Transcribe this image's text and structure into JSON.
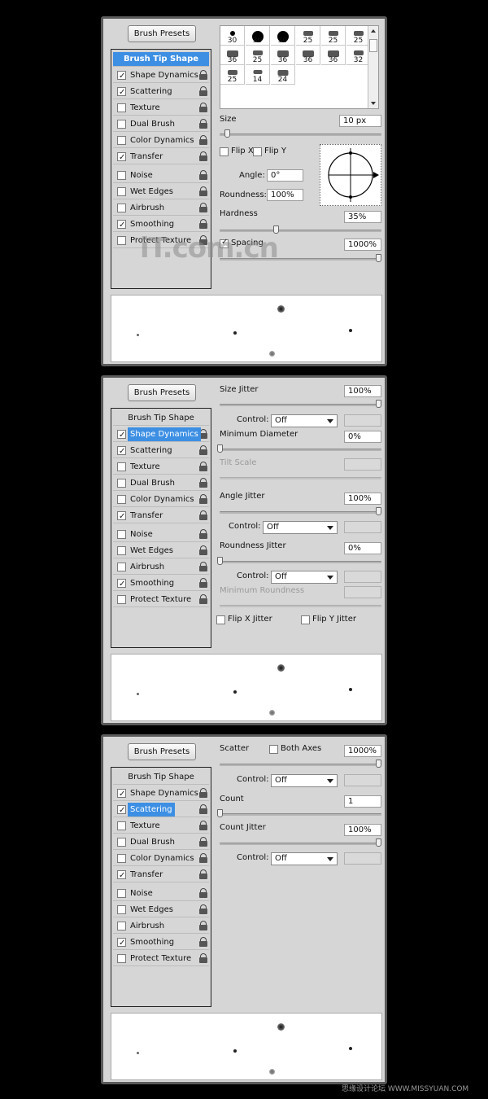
{
  "panels": [
    {
      "presets_label": "Brush Presets",
      "selected": "Brush Tip Shape",
      "sidebar": [
        {
          "label": "Brush Tip Shape",
          "title": true,
          "selected": true
        },
        {
          "label": "Shape Dynamics",
          "checked": true
        },
        {
          "label": "Scattering",
          "checked": true
        },
        {
          "label": "Texture",
          "checked": false
        },
        {
          "label": "Dual Brush",
          "checked": false
        },
        {
          "label": "Color Dynamics",
          "checked": false
        },
        {
          "label": "Transfer",
          "checked": true
        },
        {
          "label": "Noise",
          "checked": false
        },
        {
          "label": "Wet Edges",
          "checked": false
        },
        {
          "label": "Airbrush",
          "checked": false
        },
        {
          "label": "Smoothing",
          "checked": true
        },
        {
          "label": "Protect Texture",
          "checked": false
        }
      ],
      "brush_grid": [
        "30",
        "30",
        "30",
        "25",
        "25",
        "25",
        "36",
        "25",
        "36",
        "36",
        "36",
        "32",
        "25",
        "14",
        "24"
      ],
      "size_label": "Size",
      "size_value": "10 px",
      "flip_x": "Flip X",
      "flip_y": "Flip Y",
      "angle_label": "Angle:",
      "angle_value": "0°",
      "roundness_label": "Roundness:",
      "roundness_value": "100%",
      "hardness_label": "Hardness",
      "hardness_value": "35%",
      "spacing_label": "Spacing",
      "spacing_value": "1000%",
      "watermark": "iT.com.cn"
    },
    {
      "presets_label": "Brush Presets",
      "selected": "Shape Dynamics",
      "size_jitter_label": "Size Jitter",
      "size_jitter_value": "100%",
      "control_label": "Control:",
      "control_value": "Off",
      "min_diameter_label": "Minimum Diameter",
      "min_diameter_value": "0%",
      "tilt_scale_label": "Tilt Scale",
      "angle_jitter_label": "Angle Jitter",
      "angle_jitter_value": "100%",
      "roundness_jitter_label": "Roundness Jitter",
      "roundness_jitter_value": "0%",
      "min_roundness_label": "Minimum Roundness",
      "flip_x_jitter": "Flip X Jitter",
      "flip_y_jitter": "Flip Y Jitter"
    },
    {
      "presets_label": "Brush Presets",
      "selected": "Scattering",
      "scatter_label": "Scatter",
      "both_axes_label": "Both Axes",
      "scatter_value": "1000%",
      "control_label": "Control:",
      "control_value": "Off",
      "count_label": "Count",
      "count_value": "1",
      "count_jitter_label": "Count Jitter",
      "count_jitter_value": "100%"
    }
  ],
  "footer_watermark": "思缘设计论坛 WWW.MISSYUAN.COM"
}
